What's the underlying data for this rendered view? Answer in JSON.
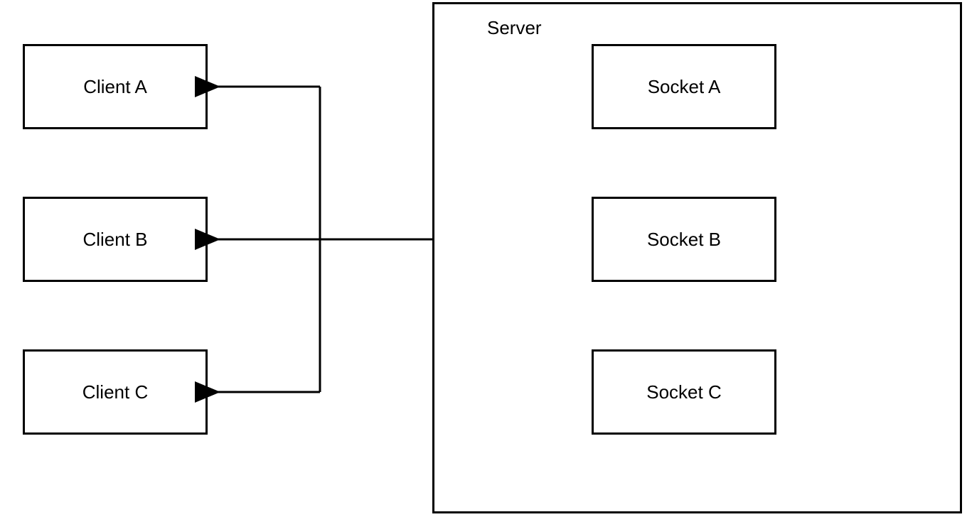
{
  "clients": [
    {
      "label": "Client A"
    },
    {
      "label": "Client B"
    },
    {
      "label": "Client C"
    }
  ],
  "server": {
    "label": "Server"
  },
  "sockets": [
    {
      "label": "Socket A"
    },
    {
      "label": "Socket B"
    },
    {
      "label": "Socket C"
    }
  ]
}
